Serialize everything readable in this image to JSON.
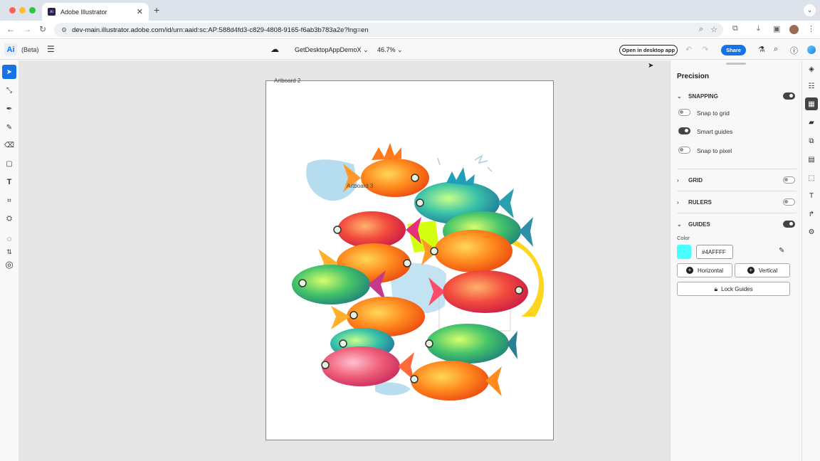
{
  "browser": {
    "tab_title": "Adobe Illustrator",
    "tab_favicon": "Ai",
    "url": "dev-main.illustrator.adobe.com/id/urn:aaid:sc:AP:588d4fd3-c829-4808-9165-f6ab3b783a2e?lng=en",
    "colors": {
      "close": "#ff5f57",
      "minimize": "#febc2e",
      "maximize": "#28c840"
    }
  },
  "app": {
    "logo": "Ai",
    "beta_label": "(Beta)",
    "document_name": "GetDesktopAppDemoX",
    "zoom": "46.7%",
    "open_desktop_label": "Open in desktop app",
    "share_label": "Share",
    "accent": "#1473e6"
  },
  "canvas": {
    "artboard_2_label": "Artboard 2",
    "artboard_3_label": "Artboard 3"
  },
  "panel": {
    "title": "Precision",
    "snapping": {
      "label": "SNAPPING",
      "enabled": true,
      "options": [
        {
          "label": "Snap to grid",
          "enabled": false
        },
        {
          "label": "Smart guides",
          "enabled": true
        },
        {
          "label": "Snap to pixel",
          "enabled": false
        }
      ]
    },
    "grid": {
      "label": "GRID",
      "enabled": false
    },
    "rulers": {
      "label": "RULERS",
      "enabled": false
    },
    "guides": {
      "label": "GUIDES",
      "enabled": true,
      "color_label": "Color",
      "color_hex": "#4AFFFF",
      "horizontal_label": "Horizontal",
      "vertical_label": "Vertical",
      "lock_label": "Lock Guides"
    }
  }
}
